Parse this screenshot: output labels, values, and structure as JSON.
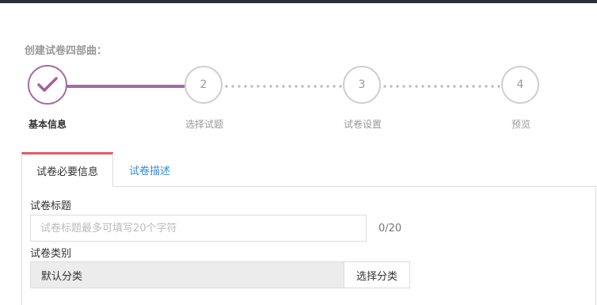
{
  "steps": {
    "title": "创建试卷四部曲：",
    "items": [
      {
        "number": "",
        "label": "基本信息",
        "state": "done"
      },
      {
        "number": "2",
        "label": "选择试题",
        "state": "pending"
      },
      {
        "number": "3",
        "label": "试卷设置",
        "state": "pending"
      },
      {
        "number": "4",
        "label": "预览",
        "state": "pending"
      }
    ],
    "accent_color": "#a46aa6"
  },
  "tabs": [
    {
      "label": "试卷必要信息",
      "active": true
    },
    {
      "label": "试卷描述",
      "active": false
    }
  ],
  "form": {
    "title_label": "试卷标题",
    "title_placeholder": "试卷标题最多可填写20个字符",
    "title_counter": "0/20",
    "category_label": "试卷类别",
    "category_value": "默认分类",
    "category_button": "选择分类"
  },
  "icons": {
    "step1": "checkmark-icon"
  }
}
